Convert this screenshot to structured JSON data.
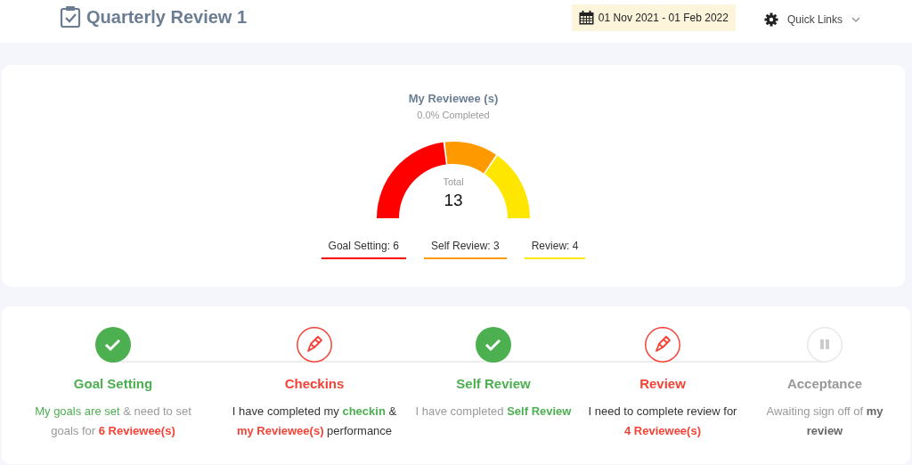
{
  "header": {
    "title": "Quarterly Review 1",
    "date_range": "01 Nov 2021 - 01 Feb 2022",
    "quick_links": "Quick Links"
  },
  "summary": {
    "title": "My Reviewee (s)",
    "subtitle": "0.0% Completed",
    "total_label": "Total",
    "total": "13",
    "legend": [
      {
        "label": "Goal Setting:",
        "count": "6",
        "color": "#ff0000"
      },
      {
        "label": "Self Review:",
        "count": "3",
        "color": "#ff9900"
      },
      {
        "label": "Review:",
        "count": "4",
        "color": "#ffe600"
      }
    ]
  },
  "steps": [
    {
      "title": "Goal Setting",
      "kind": "done",
      "description": [
        {
          "text": "My goals are set",
          "kind": "done"
        },
        {
          "text": " & need to set goals for ",
          "kind": "muted"
        },
        {
          "text": "**6 Reviewee(s)**",
          "kind": "todo"
        }
      ]
    },
    {
      "title": "Checkins",
      "kind": "in_progress",
      "description": [
        {
          "text": "I have completed my ",
          "kind": "plain"
        },
        {
          "text": "**checkin**",
          "kind": "done"
        },
        {
          "text": " & ",
          "kind": "plain"
        },
        {
          "text": "**my Reviewee(s)**",
          "kind": "todo"
        },
        {
          "text": " performance",
          "kind": "plain"
        }
      ]
    },
    {
      "title": "Self Review",
      "kind": "done",
      "description": [
        {
          "text": "I have completed ",
          "kind": "muted"
        },
        {
          "text": "**Self Review**",
          "kind": "done"
        }
      ]
    },
    {
      "title": "Review",
      "kind": "in_progress",
      "description": [
        {
          "text": "I need to complete review for ",
          "kind": "plain"
        },
        {
          "text": "**4 Reviewee(s)**",
          "kind": "todo"
        }
      ]
    },
    {
      "title": "Acceptance",
      "kind": "pending",
      "description": [
        {
          "text": "Awaiting sign off of ",
          "kind": "muted"
        },
        {
          "text": "**my review**",
          "kind": "strong"
        }
      ]
    }
  ]
}
